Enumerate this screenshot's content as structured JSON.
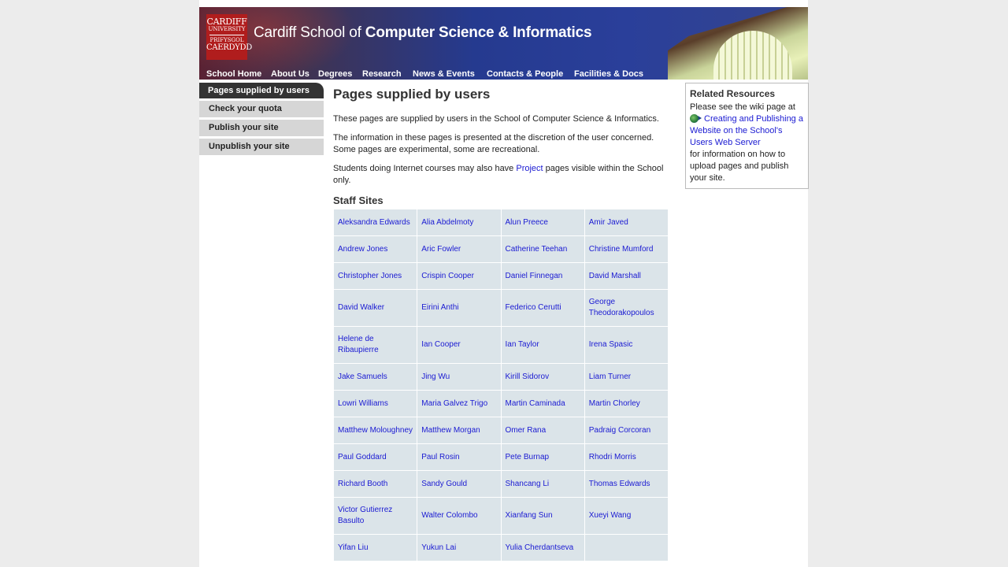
{
  "header": {
    "logo": {
      "line1": "CARDIFF",
      "line2": "UNIVERSITY",
      "line3": "PRIFYSGOL",
      "line4": "CAERDYDD"
    },
    "title_prefix": "Cardiff School of ",
    "title_bold": "Computer Science & Informatics",
    "nav": [
      "School Home",
      "About Us",
      "Degrees",
      "Research",
      "News & Events",
      "Contacts & People",
      "Facilities & Docs"
    ]
  },
  "sidebar": {
    "items": [
      {
        "label": "Pages supplied by users",
        "active": true
      },
      {
        "label": "Check your quota"
      },
      {
        "label": "Publish your site"
      },
      {
        "label": "Unpublish your site"
      }
    ]
  },
  "main": {
    "title": "Pages supplied by users",
    "para1": "These pages are supplied by users in the School of Computer Science & Informatics.",
    "para2": "The information in these pages is presented at the discretion of the user concerned. Some pages are experimental, some are recreational.",
    "para3_before": "Students doing Internet courses may also have ",
    "para3_link": "Project",
    "para3_after": " pages visible within the School only.",
    "section_title": "Staff Sites",
    "staff": [
      [
        "Aleksandra Edwards",
        "Alia Abdelmoty",
        "Alun Preece",
        "Amir Javed"
      ],
      [
        "Andrew Jones",
        "Aric Fowler",
        "Catherine Teehan",
        "Christine Mumford"
      ],
      [
        "Christopher Jones",
        "Crispin Cooper",
        "Daniel Finnegan",
        "David Marshall"
      ],
      [
        "David Walker",
        "Eirini Anthi",
        "Federico Cerutti",
        "George Theodorakopoulos"
      ],
      [
        "Helene de Ribaupierre",
        "Ian Cooper",
        "Ian Taylor",
        "Irena Spasic"
      ],
      [
        "Jake Samuels",
        "Jing Wu",
        "Kirill Sidorov",
        "Liam Turner"
      ],
      [
        "Lowri Williams",
        "Maria Galvez Trigo",
        "Martin Caminada",
        "Martin Chorley"
      ],
      [
        "Matthew Moloughney",
        "Matthew Morgan",
        "Omer Rana",
        "Padraig Corcoran"
      ],
      [
        "Paul Goddard",
        "Paul Rosin",
        "Pete Burnap",
        "Rhodri Morris"
      ],
      [
        "Richard Booth",
        "Sandy Gould",
        "Shancang Li",
        "Thomas Edwards"
      ],
      [
        "Victor Gutierrez Basulto",
        "Walter Colombo",
        "Xianfang Sun",
        "Xueyi Wang"
      ],
      [
        "Yifan Liu",
        "Yukun Lai",
        "Yulia Cherdantseva",
        ""
      ]
    ]
  },
  "related": {
    "title": "Related Resources",
    "intro": "Please see the wiki page at",
    "link": "Creating and Publishing a Website on the School's Users Web Server",
    "outro": "for information on how to upload pages and publish your site.",
    "icon": "globe-link-icon"
  },
  "colors": {
    "link": "#1a1ad2",
    "banner": "#2a3f9a",
    "table_bg": "#dbe4e9",
    "menu_active": "#333333",
    "menu_bg": "#d6d6d6"
  }
}
